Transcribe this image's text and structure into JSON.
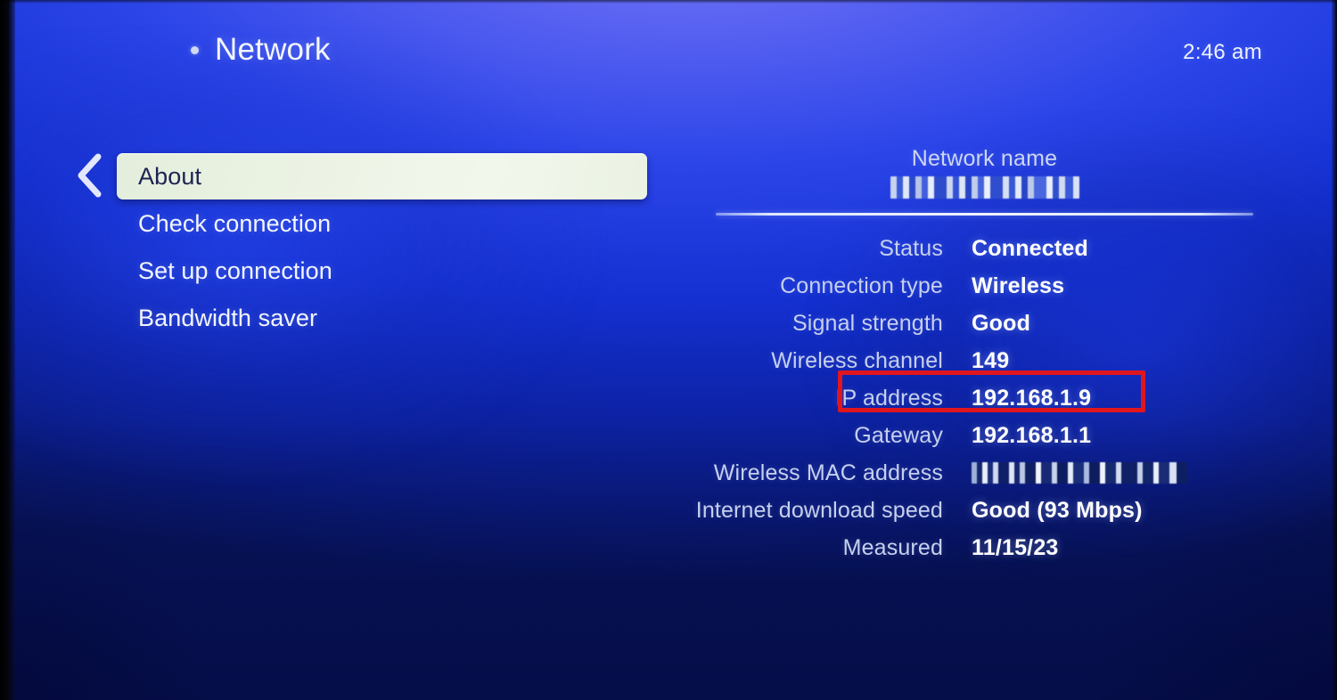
{
  "header": {
    "title": "Network",
    "bullet_icon": "dot-icon",
    "clock": "2:46 am"
  },
  "nav": {
    "back_icon": "chevron-left-icon",
    "items": [
      {
        "label": "About",
        "selected": true
      },
      {
        "label": "Check connection",
        "selected": false
      },
      {
        "label": "Set up connection",
        "selected": false
      },
      {
        "label": "Bandwidth saver",
        "selected": false
      }
    ]
  },
  "panel": {
    "network_name_label": "Network name",
    "network_name_value": "",
    "network_name_redacted": true,
    "details": [
      {
        "label": "Status",
        "value": "Connected",
        "redacted": false
      },
      {
        "label": "Connection type",
        "value": "Wireless",
        "redacted": false
      },
      {
        "label": "Signal strength",
        "value": "Good",
        "redacted": false
      },
      {
        "label": "Wireless channel",
        "value": "149",
        "redacted": false
      },
      {
        "label": "IP address",
        "value": "192.168.1.9",
        "redacted": false,
        "highlighted": true
      },
      {
        "label": "Gateway",
        "value": "192.168.1.1",
        "redacted": false
      },
      {
        "label": "Wireless MAC address",
        "value": "",
        "redacted": true
      },
      {
        "label": "Internet download speed",
        "value": "Good (93 Mbps)",
        "redacted": false
      },
      {
        "label": "Measured",
        "value": "11/15/23",
        "redacted": false
      }
    ]
  },
  "annotation": {
    "highlight_color": "#e0161f",
    "highlight_target": "IP address"
  },
  "colors": {
    "background_light": "#6b74f5",
    "background_mid": "#1430d0",
    "background_dark": "#0a1b82",
    "selected_pill": "#ecf3e4",
    "selected_text": "#1e2352",
    "label_text": "#c6d0ee",
    "value_text": "#ffffff"
  }
}
